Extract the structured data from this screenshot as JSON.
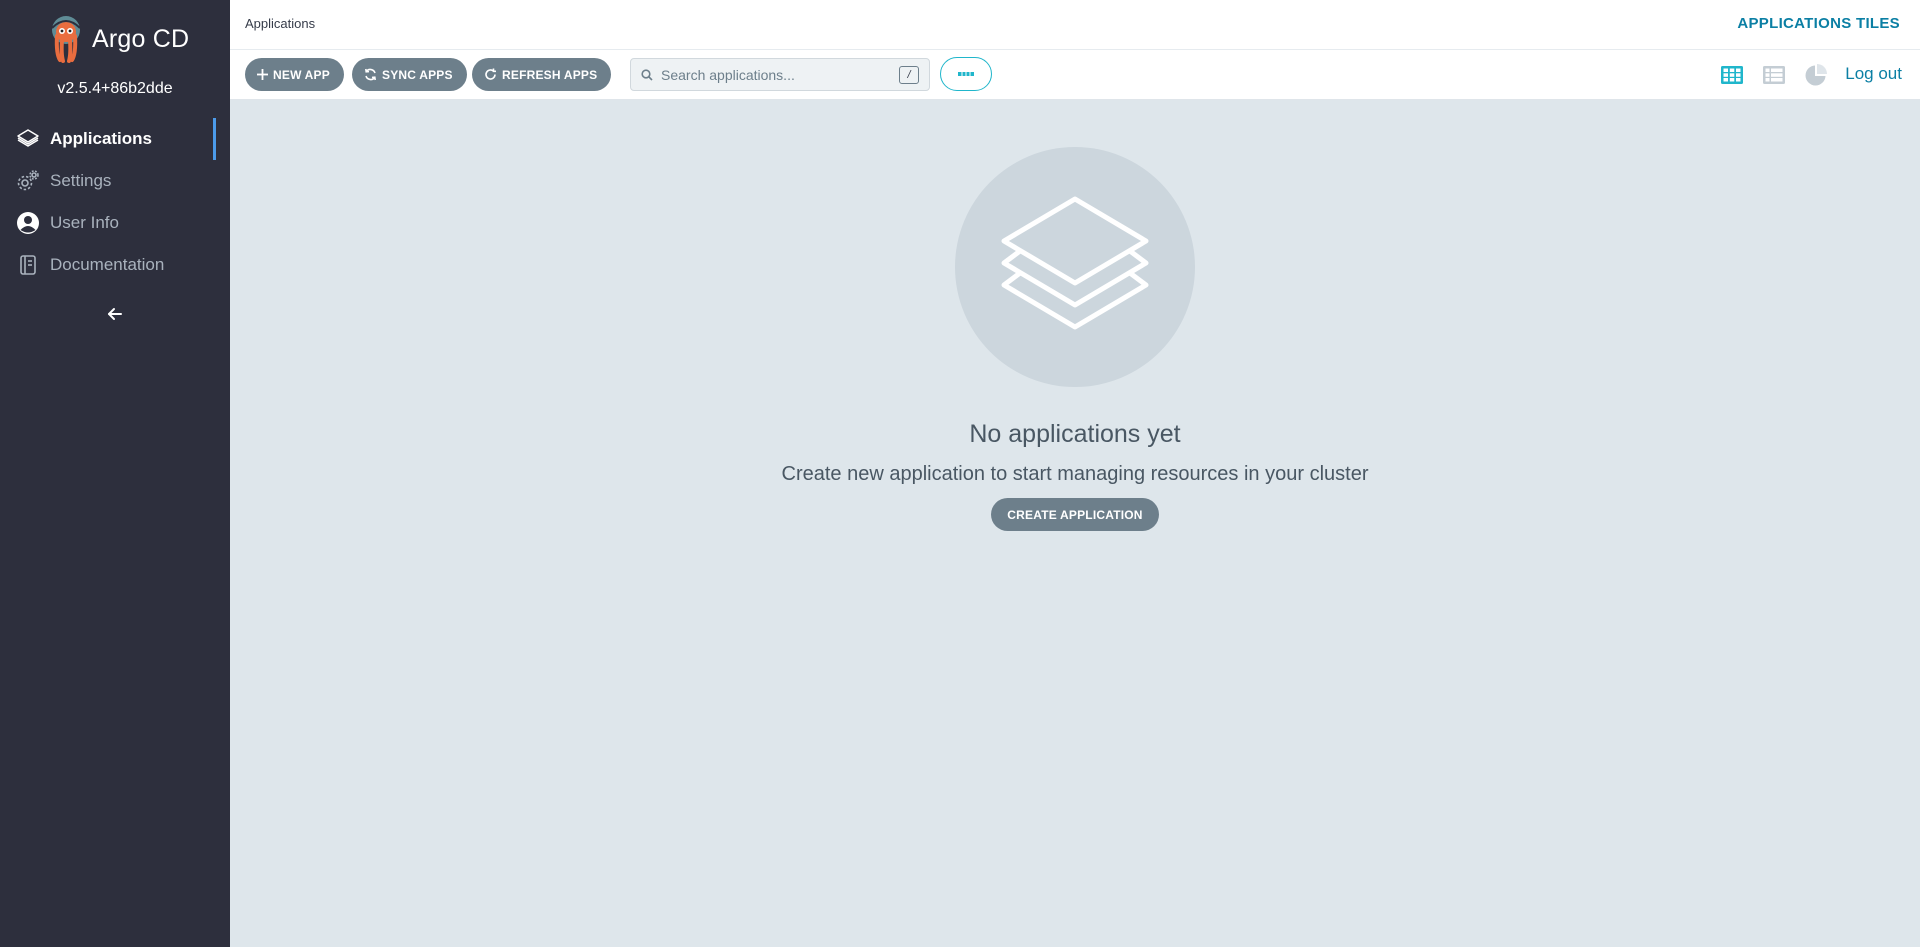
{
  "app": {
    "name": "Argo CD",
    "version": "v2.5.4+86b2dde"
  },
  "sidebar": {
    "items": [
      {
        "label": "Applications",
        "icon": "layers-icon",
        "active": true
      },
      {
        "label": "Settings",
        "icon": "gears-icon",
        "active": false
      },
      {
        "label": "User Info",
        "icon": "user-circle-icon",
        "active": false
      },
      {
        "label": "Documentation",
        "icon": "book-icon",
        "active": false
      }
    ],
    "collapse_icon": "arrow-left-icon"
  },
  "topbar": {
    "breadcrumb": "Applications",
    "title": "APPLICATIONS TILES"
  },
  "toolbar": {
    "new_app": "NEW APP",
    "sync_apps": "SYNC APPS",
    "refresh_apps": "REFRESH APPS",
    "search_placeholder": "Search applications...",
    "search_value": "",
    "search_shortcut": "/",
    "logout": "Log out",
    "views": [
      "tiles-view-icon",
      "list-view-icon",
      "summary-view-icon"
    ],
    "active_view": "tiles"
  },
  "empty_state": {
    "title": "No applications yet",
    "subtitle": "Create new application to start managing resources in your cluster",
    "button": "CREATE APPLICATION"
  },
  "colors": {
    "sidebar_bg": "#2d2f3d",
    "content_bg": "#dee6eb",
    "accent": "#0b7fa4",
    "button_bg": "#6d7f8b",
    "active_indicator": "#4c9bea"
  }
}
